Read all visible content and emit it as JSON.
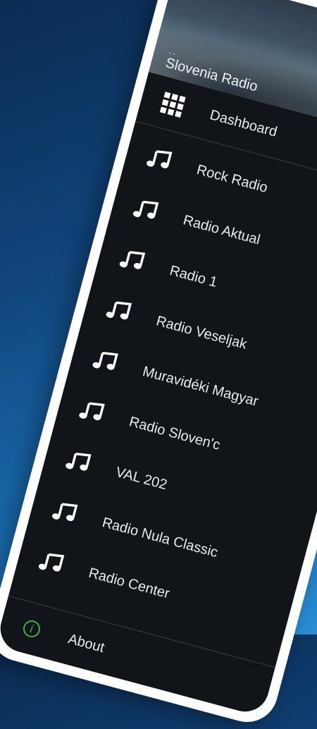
{
  "drawer": {
    "header_dots": "..",
    "title": "Slovenia Radio"
  },
  "menu": {
    "dashboard_label": "Dashboard",
    "items": [
      {
        "label": "Rock Radio",
        "icon": "music-note-icon"
      },
      {
        "label": "Radio Aktual",
        "icon": "music-note-icon"
      },
      {
        "label": "Radio 1",
        "icon": "music-note-icon"
      },
      {
        "label": "Radio Veseljak",
        "icon": "music-note-icon"
      },
      {
        "label": "Muravidéki Magyar",
        "icon": "music-note-icon"
      },
      {
        "label": "Radio Sloven'c",
        "icon": "music-note-icon"
      },
      {
        "label": "VAL 202",
        "icon": "music-note-icon"
      },
      {
        "label": "Radio Nula Classic",
        "icon": "music-note-icon"
      },
      {
        "label": "Radio Center",
        "icon": "music-note-icon"
      }
    ],
    "about_label": "About"
  },
  "colors": {
    "drawer_background": "#111418",
    "text": "#e9ecef",
    "about_icon": "#3cb04a"
  }
}
